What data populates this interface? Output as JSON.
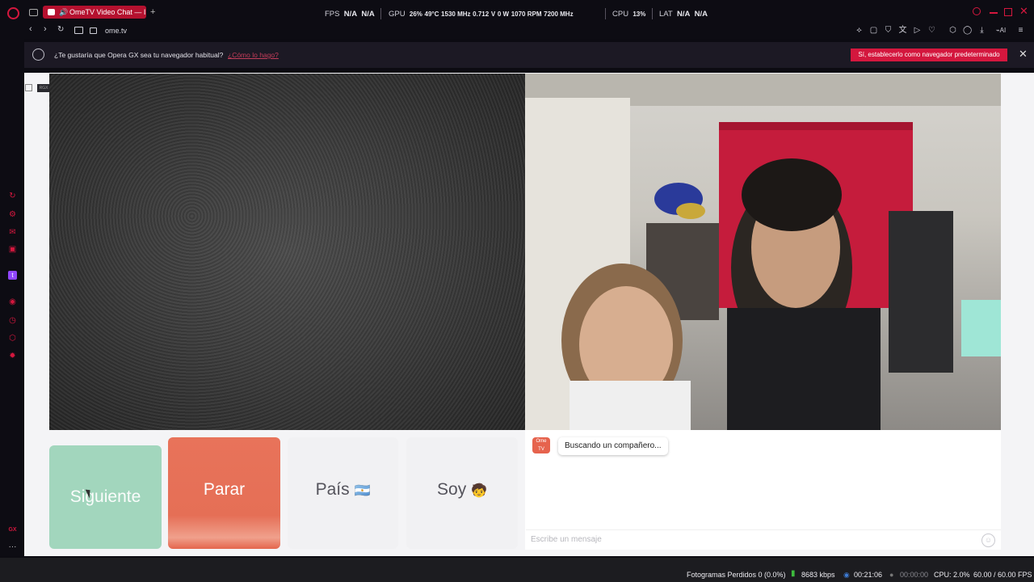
{
  "browser": {
    "tab_title": "OmeTV Video Chat — I",
    "new_tab_symbol": "+",
    "url": "ome.tv"
  },
  "hud": {
    "fps_label": "FPS",
    "fps_value_1": "N/A",
    "fps_value_2": "N/A",
    "gpu_label": "GPU",
    "gpu_load": "26%",
    "gpu_temp": "49°C",
    "gpu_clock": "1530 MHz",
    "gpu_volt": "0.712",
    "gpu_volt_unit": "V",
    "gpu_power": "0 W",
    "gpu_fan": "1070 RPM",
    "gpu_mem": "7200 MHz",
    "cpu_label": "CPU",
    "cpu_load": "13%",
    "lat_label": "LAT",
    "lat_value_1": "N/A",
    "lat_value_2": "N/A"
  },
  "notification": {
    "message": "¿Te gustaría que Opera GX sea tu navegador habitual?",
    "link": "¿Cómo lo hago?",
    "cta": "Sí, establecerlo como navegador predeterminado"
  },
  "buttons": {
    "next": "Siguiente",
    "stop": "Parar",
    "country": "País",
    "country_flag": "🇦🇷",
    "gender": "Soy",
    "gender_emoji": "🧒"
  },
  "chat": {
    "logo_text": "Ome TV",
    "status": "Buscando un compañero...",
    "input_placeholder": "Escribe un mensaje"
  },
  "obs_status": {
    "dropped_frames": "Fotogramas Perdidos 0 (0.0%)",
    "bitrate": "8683 kbps",
    "stream_time": "00:21:06",
    "record_time": "00:00:00",
    "cpu": "CPU: 2.0%",
    "fps": "60.00 / 60.00 FPS"
  },
  "colors": {
    "opera_red": "#d4173e",
    "next_button": "#a2d6bd",
    "stop_button": "#e56f56"
  }
}
